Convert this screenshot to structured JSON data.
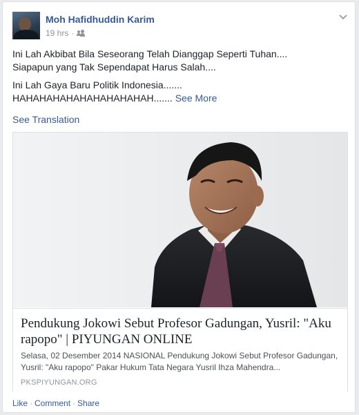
{
  "post": {
    "author": "Moh Hafidhuddin Karim",
    "time": "19 hrs",
    "audience_icon": "friends-icon",
    "menu_icon": "chevron-down-icon",
    "text_line1": "Ini Lah Akbibat Bila Seseorang Telah Dianggap Seperti Tuhan....",
    "text_line2": "Siapapun yang Tak Sependapat Harus Salah....",
    "text_line3": "Ini Lah Gaya Baru Politik Indonesia.......",
    "text_line4": "HAHAHAHAHAHAHAHAHAHAH.......",
    "see_more": "See More",
    "see_translation": "See Translation"
  },
  "link_preview": {
    "title": "Pendukung Jokowi Sebut Profesor Gadungan, Yusril: \"Aku rapopo\" | PIYUNGAN ONLINE",
    "description": "Selasa, 02 Desember 2014 NASIONAL Pendukung Jokowi Sebut Profesor Gadungan, Yusril: \"Aku rapopo\" Pakar Hukum Tata Negara Yusril Ihza Mahendra...",
    "domain": "PKSPIYUNGAN.ORG"
  },
  "actions": {
    "like": "Like",
    "comment": "Comment",
    "share": "Share",
    "separator": "·"
  },
  "colors": {
    "link_blue": "#365899",
    "text_dark": "#1d2129",
    "meta_gray": "#90949c",
    "border": "#dddfe2"
  }
}
